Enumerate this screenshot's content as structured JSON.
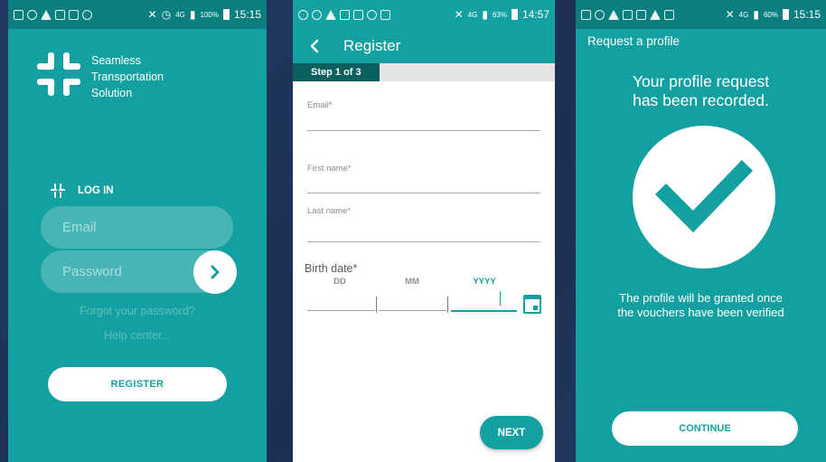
{
  "screen1": {
    "status": {
      "battery": "100%",
      "network": "4G",
      "time": "15:15"
    },
    "logo_lines": [
      "Seamless",
      "Transportation",
      "Solution"
    ],
    "login_heading": "LOG IN",
    "email_placeholder": "Email",
    "password_placeholder": "Password",
    "forgot_password": "Forgot your password?",
    "help_center": "Help center...",
    "register_label": "REGISTER"
  },
  "screen2": {
    "status": {
      "battery": "63%",
      "network": "4G",
      "time": "14:57"
    },
    "title": "Register",
    "step_label": "Step 1 of 3",
    "progress": 0.333,
    "fields": {
      "email": "Email*",
      "first_name": "First name*",
      "last_name": "Last name*"
    },
    "birth_date": {
      "label": "Birth date*",
      "day": "DD",
      "month": "MM",
      "year": "YYYY"
    },
    "next_label": "NEXT"
  },
  "screen3": {
    "status": {
      "battery": "60%",
      "network": "4G",
      "time": "15:15"
    },
    "title": "Request a profile",
    "message_line1": "Your profile request",
    "message_line2": "has been recorded.",
    "note_line1": "The profile will be granted once",
    "note_line2": "the vouchers have been verified",
    "continue_label": "CONTINUE"
  },
  "colors": {
    "primary": "#14a0a0",
    "primary_dark": "#0c5f5f",
    "background": "#1f3459"
  }
}
